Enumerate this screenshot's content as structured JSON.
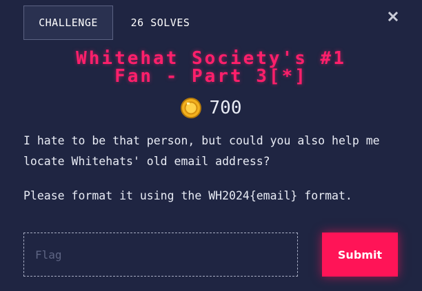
{
  "tabs": {
    "challenge_label": "CHALLENGE",
    "solves_label": "26 SOLVES"
  },
  "icons": {
    "close": "close-icon",
    "coin": "coin-icon"
  },
  "challenge": {
    "title_line1": "Whitehat Society's #1",
    "title_line2": "Fan - Part 3[*]",
    "points": "700",
    "description": [
      "I hate to be that person, but could you also help me locate Whitehats' old email address?",
      "Please format it using the WH2024{email} format."
    ]
  },
  "form": {
    "flag_placeholder": "Flag",
    "submit_label": "Submit"
  },
  "colors": {
    "background": "#1f2542",
    "accent": "#ff1f6b",
    "button": "#ff1457",
    "coin": "#f2b01e"
  }
}
